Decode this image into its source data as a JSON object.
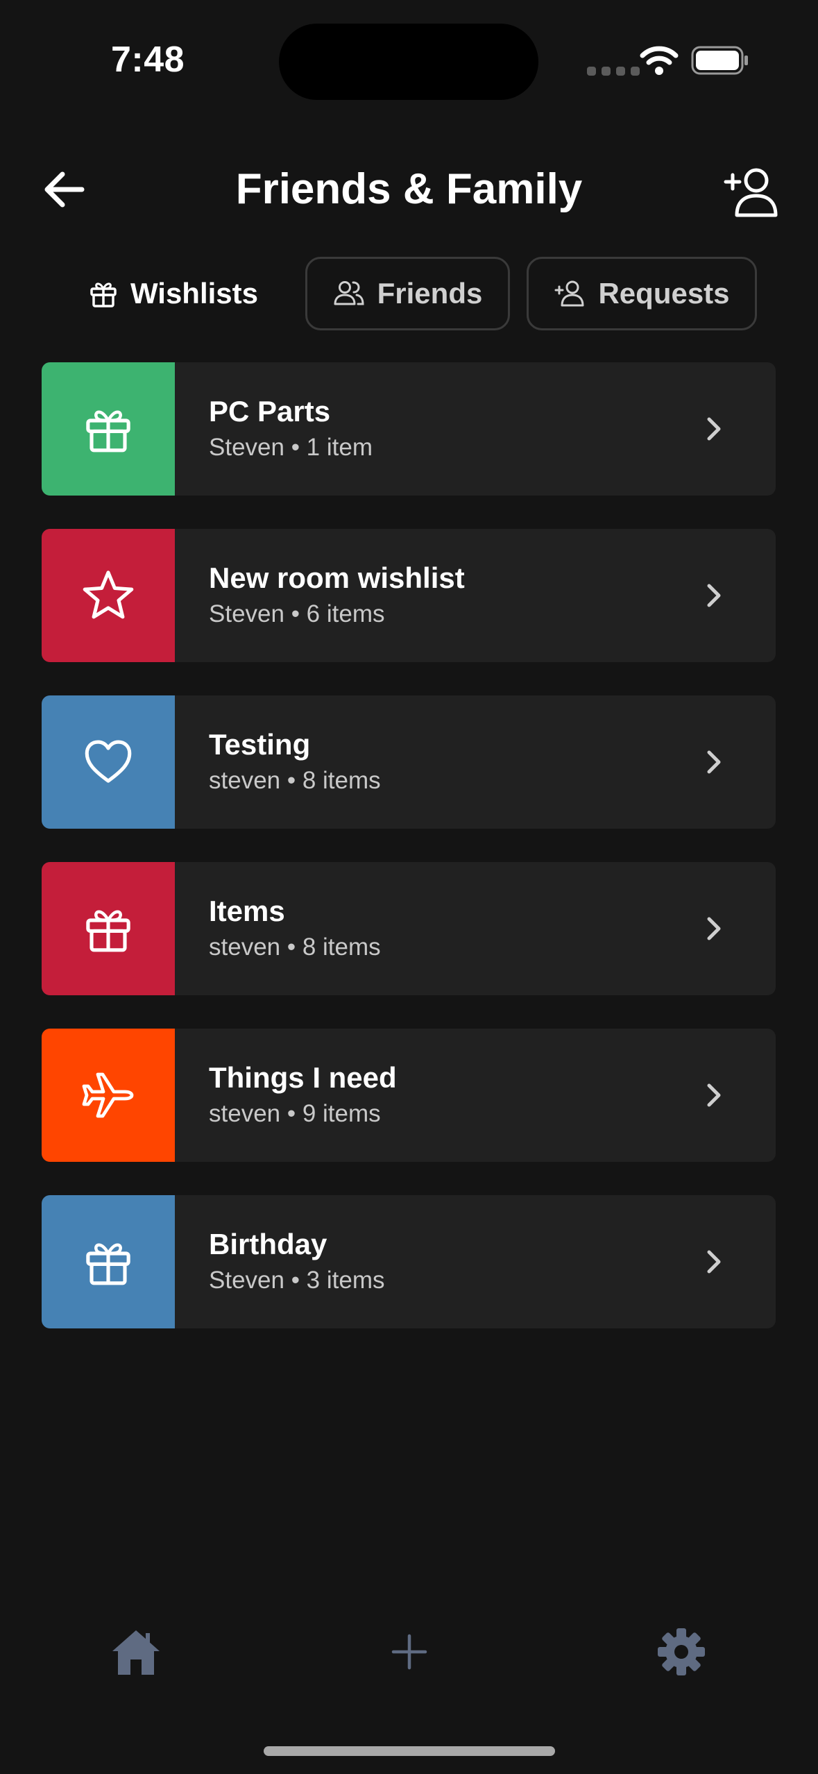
{
  "status_bar": {
    "time": "7:48"
  },
  "header": {
    "title": "Friends & Family"
  },
  "tabs": [
    {
      "label": "Wishlists",
      "icon": "gift-icon",
      "active": true
    },
    {
      "label": "Friends",
      "icon": "users-icon",
      "active": false
    },
    {
      "label": "Requests",
      "icon": "user-plus-icon",
      "active": false
    }
  ],
  "wishlists": [
    {
      "title": "PC Parts",
      "owner": "Steven",
      "count": "1 item",
      "icon": "gift-icon",
      "color": "#3DB370"
    },
    {
      "title": "New room wishlist",
      "owner": "Steven",
      "count": "6 items",
      "icon": "star-icon",
      "color": "#C41E3A"
    },
    {
      "title": "Testing",
      "owner": "steven",
      "count": "8 items",
      "icon": "heart-icon",
      "color": "#4682B4"
    },
    {
      "title": "Items",
      "owner": "steven",
      "count": "8 items",
      "icon": "gift-icon",
      "color": "#C41E3A"
    },
    {
      "title": "Things I need",
      "owner": "steven",
      "count": "9 items",
      "icon": "airplane-icon",
      "color": "#FF4500"
    },
    {
      "title": "Birthday",
      "owner": "Steven",
      "count": "3 items",
      "icon": "gift-icon",
      "color": "#4682B4"
    }
  ],
  "bottom_nav": [
    {
      "name": "home",
      "icon": "home-icon"
    },
    {
      "name": "add",
      "icon": "plus-icon"
    },
    {
      "name": "settings",
      "icon": "gear-icon"
    }
  ],
  "colors": {
    "background": "#141414",
    "card": "#212121",
    "nav_icon": "#5F6B82"
  }
}
